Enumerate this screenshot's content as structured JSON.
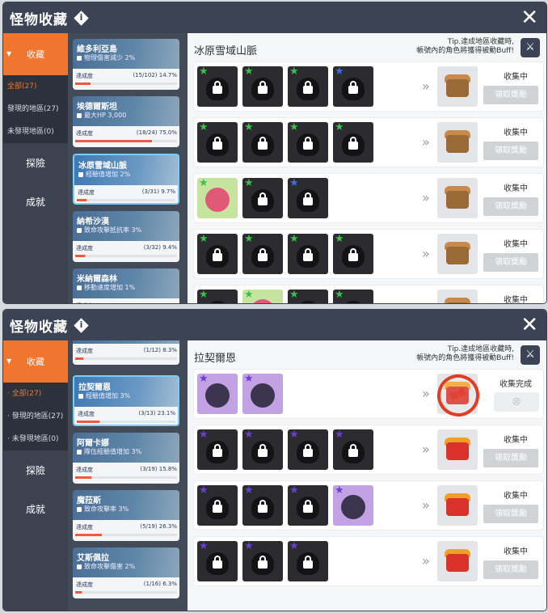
{
  "title": "怪物收藏",
  "info_icon": "i",
  "close_icon": "✕",
  "sidebar": {
    "collect": "收藏",
    "all": "全部(27)",
    "found": "發現的地區(27)",
    "unfound": "未發現地區(0)",
    "explore": "探險",
    "achieve": "成就",
    "found_alt": "發現的地區(27)",
    "unfound_alt": "未發現地區(0)"
  },
  "progress_label": "達成度",
  "tip": {
    "line1": "Tip.達成地區收藏時,",
    "line2": "帳號內的角色將獲得被動Buff!"
  },
  "status": {
    "collecting": "收集中",
    "done": "收集完成",
    "claim": "領取獎勵",
    "stamp": "完成"
  },
  "top": {
    "region": "冰原雪域山脈",
    "cards": [
      {
        "name": "維多利亞島",
        "buff": "物理傷害減少 2%",
        "progress": "(15/102) 14.7%",
        "pct": 14.7
      },
      {
        "name": "埃德爾斯坦",
        "buff": "最大HP 3,000",
        "progress": "(18/24) 75.0%",
        "pct": 75.0
      },
      {
        "name": "冰原雪域山脈",
        "buff": "經驗值增加 2%",
        "progress": "(3/31) 9.7%",
        "pct": 9.7
      },
      {
        "name": "納希沙漠",
        "buff": "致命攻擊抵抗率 3%",
        "progress": "(3/32) 9.4%",
        "pct": 9.4
      },
      {
        "name": "米納爾森林",
        "buff": "移動速度增加 1%",
        "progress": "",
        "pct": 0
      }
    ]
  },
  "bottom": {
    "region": "拉契爾恩",
    "cards": [
      {
        "name": "",
        "buff": "",
        "progress": "(1/12) 8.3%",
        "pct": 8.3
      },
      {
        "name": "拉契爾恩",
        "buff": "經驗值增加 3%",
        "progress": "(3/13) 23.1%",
        "pct": 23.1
      },
      {
        "name": "阿爾卡娜",
        "buff": "隊伍經驗值增加 3%",
        "progress": "(3/19) 15.8%",
        "pct": 15.8
      },
      {
        "name": "魔菈斯",
        "buff": "致命攻擊率 3%",
        "progress": "(5/19) 26.3%",
        "pct": 26.3
      },
      {
        "name": "艾斯佩拉",
        "buff": "致命攻擊傷害 2%",
        "progress": "(1/16) 6.3%",
        "pct": 6.3
      }
    ]
  },
  "colors": {
    "accent": "#f07630",
    "header": "#3b4354",
    "star_green": "#37c24a",
    "star_blue": "#3b6fe0",
    "star_purple": "#6a3fd6",
    "progress": "#f05a3a"
  }
}
